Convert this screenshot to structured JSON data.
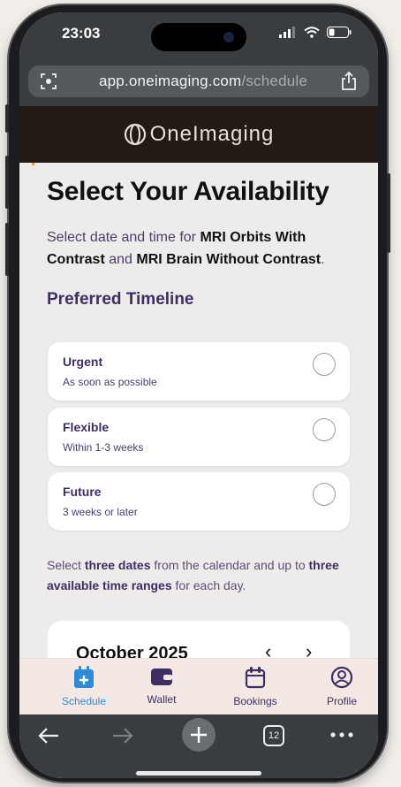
{
  "status_bar": {
    "time": "23:03"
  },
  "browser": {
    "url_domain": "app.oneimaging.com",
    "url_path": "/schedule",
    "tabs_count": "12"
  },
  "brand": {
    "name": "OneImaging"
  },
  "page": {
    "title": "Select Your Availability",
    "intro_prefix": "Select date and time for ",
    "procedure_1": "MRI Orbits With Contrast",
    "intro_and": " and ",
    "procedure_2": "MRI Brain Without Contrast",
    "intro_suffix": ".",
    "timeline_heading": "Preferred Timeline",
    "options": [
      {
        "title": "Urgent",
        "subtitle": "As soon as possible"
      },
      {
        "title": "Flexible",
        "subtitle": "Within 1-3 weeks"
      },
      {
        "title": "Future",
        "subtitle": "3 weeks or later"
      }
    ],
    "note_prefix": "Select ",
    "note_bold_1": "three dates",
    "note_middle": " from the calendar and up to ",
    "note_bold_2": "three available time ranges",
    "note_suffix": " for each day.",
    "calendar_month": "October 2025",
    "prev_icon": "‹",
    "next_icon": "›"
  },
  "tabbar": {
    "items": [
      {
        "label": "Schedule",
        "icon": "calendar-plus-icon"
      },
      {
        "label": "Wallet",
        "icon": "wallet-icon"
      },
      {
        "label": "Bookings",
        "icon": "calendar-icon"
      },
      {
        "label": "Profile",
        "icon": "user-circle-icon"
      }
    ]
  },
  "colors": {
    "brand_bar": "#241a15",
    "heading_purple": "#3d2e63",
    "active_tab": "#2d8bd8",
    "tabbar_bg": "#f3e8e4"
  }
}
